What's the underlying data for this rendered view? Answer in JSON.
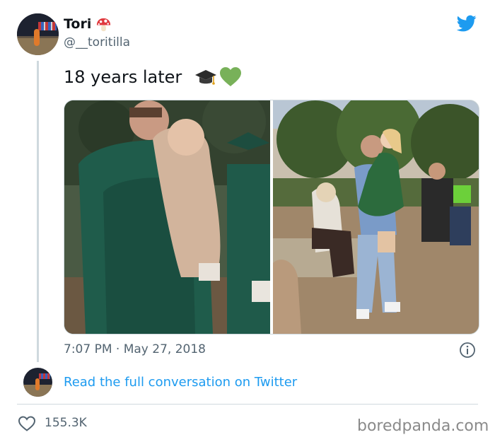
{
  "author": {
    "display_name": "Tori",
    "name_emoji": "mushroom-icon",
    "handle": "@__toritilla"
  },
  "tweet": {
    "text": "18 years later",
    "emojis": [
      "graduation-cap-icon",
      "green-heart-icon"
    ],
    "timestamp": "7:07 PM · May 27, 2018"
  },
  "media": {
    "images": [
      {
        "description_name": "left-photo"
      },
      {
        "description_name": "right-photo"
      }
    ]
  },
  "footer": {
    "read_more": "Read the full conversation on Twitter",
    "likes": "155.3K"
  },
  "watermark": "boredpanda.com",
  "colors": {
    "twitter_blue": "#1d9bf0",
    "text_secondary": "#536471",
    "text_primary": "#0f1419",
    "divider": "#cfd9de"
  }
}
